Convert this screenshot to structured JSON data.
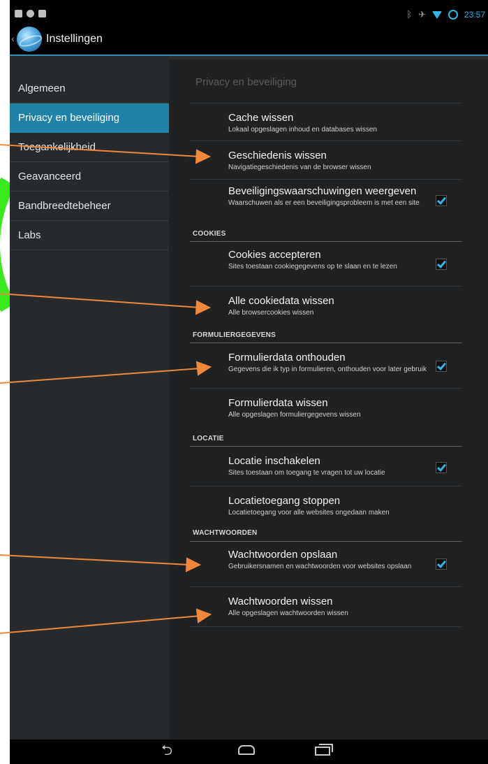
{
  "status_bar": {
    "time": "23:57"
  },
  "action_bar": {
    "title": "Instellingen"
  },
  "sidebar": {
    "items": [
      {
        "label": "Algemeen"
      },
      {
        "label": "Privacy en beveiliging"
      },
      {
        "label": "Toegankelijkheid"
      },
      {
        "label": "Geavanceerd"
      },
      {
        "label": "Bandbreedtebeheer"
      },
      {
        "label": "Labs"
      }
    ],
    "active": "Privacy en beveiliging"
  },
  "panel": {
    "title": "Privacy en beveiliging",
    "rows": [
      {
        "title": "Cache wissen",
        "subtitle": "Lokaal opgeslagen inhoud en databases wissen"
      },
      {
        "title": "Geschiedenis wissen",
        "subtitle": "Navigatiegeschiedenis van de browser wissen"
      },
      {
        "title": "Beveiligingswaarschuwingen weergeven",
        "subtitle": "Waarschuwen als er een beveiligingsprobleem is met een site",
        "checked": true
      },
      {
        "title": "Cookies accepteren",
        "subtitle": "Sites toestaan cookiegegevens op te slaan en te lezen",
        "checked": true
      },
      {
        "title": "Alle cookiedata wissen",
        "subtitle": "Alle browsercookies wissen"
      },
      {
        "title": "Formulierdata onthouden",
        "subtitle": "Gegevens die ik typ in formulieren, onthouden voor later gebruik",
        "checked": true
      },
      {
        "title": "Formulierdata wissen",
        "subtitle": "Alle opgeslagen formuliergegevens wissen"
      },
      {
        "title": "Locatie inschakelen",
        "subtitle": "Sites toestaan om toegang te vragen tot uw locatie",
        "checked": true
      },
      {
        "title": "Locatietoegang stoppen",
        "subtitle": "Locatietoegang voor alle websites ongedaan maken"
      },
      {
        "title": "Wachtwoorden opslaan",
        "subtitle": "Gebruikersnamen en wachtwoorden voor websites opslaan",
        "checked": true
      },
      {
        "title": "Wachtwoorden wissen",
        "subtitle": "Alle opgeslagen wachtwoorden wissen"
      }
    ],
    "sections": {
      "cookies": "COOKIES",
      "forms": "FORMULIERGEGEVENS",
      "location": "LOCATIE",
      "passwords": "WACHTWOORDEN"
    }
  },
  "colors": {
    "accent": "#33b5e5",
    "arrow": "#f0873a",
    "decor_green": "#3ae81e",
    "active_item": "#2082a8"
  },
  "icons": {
    "back": "back-arrow-icon",
    "home": "home-icon",
    "recents": "recent-apps-icon"
  }
}
